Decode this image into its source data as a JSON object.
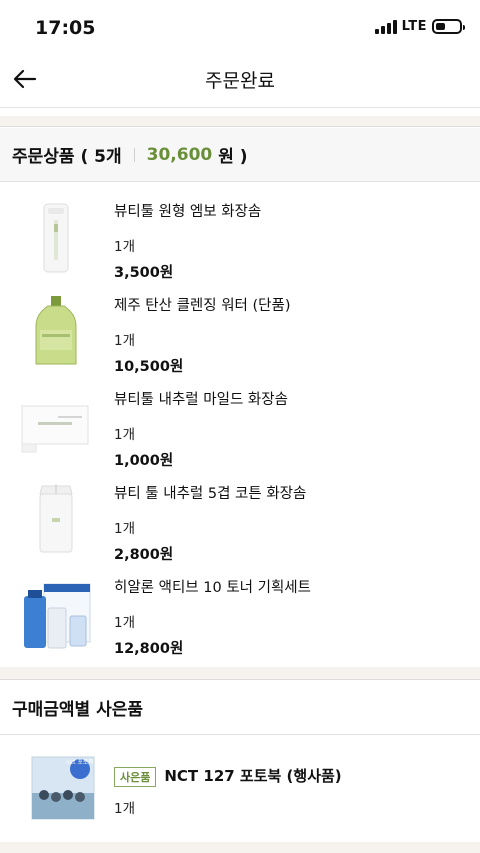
{
  "status": {
    "time": "17:05",
    "network": "LTE"
  },
  "header": {
    "title": "주문완료"
  },
  "order_section": {
    "label": "주문상품 ( 5개",
    "total": "30,600",
    "unit": "원 )"
  },
  "products": [
    {
      "name": "뷰티툴 원형 엠보 화장솜",
      "qty": "1개",
      "price": "3,500원"
    },
    {
      "name": "제주 탄산 클렌징 워터 (단품)",
      "qty": "1개",
      "price": "10,500원"
    },
    {
      "name": "뷰티툴 내추럴 마일드 화장솜",
      "qty": "1개",
      "price": "1,000원"
    },
    {
      "name": "뷰티 툴 내추럴 5겹 코튼 화장솜",
      "qty": "1개",
      "price": "2,800원"
    },
    {
      "name": "히알론 액티브 10 토너 기획세트",
      "qty": "1개",
      "price": "12,800원"
    }
  ],
  "gift_section": {
    "title": "구매금액별 사은품"
  },
  "gift": {
    "tag": "사은품",
    "name": "NCT 127 포토북 (행사품)",
    "qty": "1개",
    "badge": "nct 포토북"
  },
  "colors": {
    "accent_green": "#6a8f3a",
    "band": "#f6f2ee"
  },
  "icons": {
    "back": "back-arrow-icon"
  }
}
